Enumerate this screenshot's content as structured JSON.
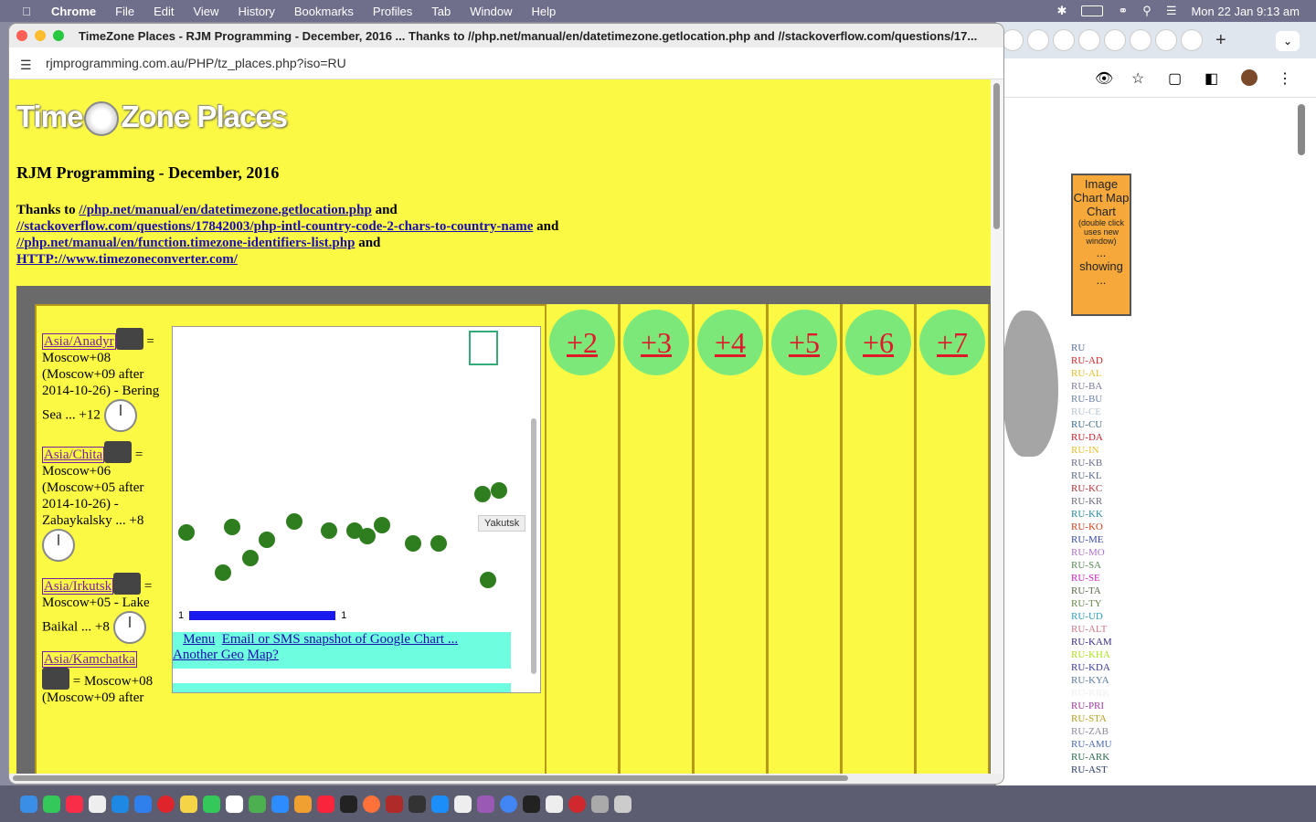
{
  "menubar": {
    "app": "Chrome",
    "items": [
      "File",
      "Edit",
      "View",
      "History",
      "Bookmarks",
      "Profiles",
      "Tab",
      "Window",
      "Help"
    ],
    "datetime": "Mon 22 Jan  9:13 am"
  },
  "window": {
    "title": "TimeZone Places - RJM Programming - December, 2016 ... Thanks to //php.net/manual/en/datetimezone.getlocation.php and //stackoverflow.com/questions/17...",
    "url": "rjmprogramming.com.au/PHP/tz_places.php?iso=RU"
  },
  "page": {
    "logo_left": "Time",
    "logo_right": "Zone Places",
    "heading": "RJM Programming - December, 2016",
    "thanks_prefix": "Thanks to",
    "links": [
      "//php.net/manual/en/datetimezone.getlocation.php",
      "//stackoverflow.com/questions/17842003/php-intl-country-code-2-chars-to-country-name",
      "//php.net/manual/en/function.timezone-identifiers-list.php",
      "HTTP://www.timezoneconverter.com/"
    ],
    "and": "and"
  },
  "places": [
    {
      "name": "Asia/Anadyr",
      "desc": "= Moscow+08 (Moscow+09 after 2014-10-26) - Bering Sea ... +12"
    },
    {
      "name": "Asia/Chita",
      "desc": "= Moscow+06 (Moscow+05 after 2014-10-26) - Zabaykalsky ... +8"
    },
    {
      "name": "Asia/Irkutsk",
      "desc": "= Moscow+05 - Lake Baikal ... +8"
    },
    {
      "name": "Asia/Kamchatka",
      "desc": "= Moscow+08 (Moscow+09 after"
    }
  ],
  "map": {
    "tooltip": "Yakutsk",
    "legend_min": "1",
    "legend_max": "1",
    "menu": "Menu",
    "email_link": "Email or SMS snapshot of Google Chart ...",
    "another_geo": "Another Geo",
    "map_q": "Map?"
  },
  "offsets": [
    "+2",
    "+3",
    "+4",
    "+5",
    "+6",
    "+7"
  ],
  "sidebar": {
    "image_chart": "Image Chart Map Chart",
    "image_chart_note": "(double click uses new window)",
    "showing": "... showing ...",
    "iso_codes": [
      {
        "code": "RU",
        "color": "#5a6ea8"
      },
      {
        "code": "RU-AD",
        "color": "#d0282c"
      },
      {
        "code": "RU-AL",
        "color": "#e3c032"
      },
      {
        "code": "RU-BA",
        "color": "#7a7a9a"
      },
      {
        "code": "RU-BU",
        "color": "#6a7fa8"
      },
      {
        "code": "RU-CE",
        "color": "#b4c4d2"
      },
      {
        "code": "RU-CU",
        "color": "#3c6a8a"
      },
      {
        "code": "RU-DA",
        "color": "#c8202a"
      },
      {
        "code": "RU-IN",
        "color": "#e8c030"
      },
      {
        "code": "RU-KB",
        "color": "#6a6a8a"
      },
      {
        "code": "RU-KL",
        "color": "#5a6a8a"
      },
      {
        "code": "RU-KC",
        "color": "#b0303a"
      },
      {
        "code": "RU-KR",
        "color": "#6a6a7a"
      },
      {
        "code": "RU-KK",
        "color": "#2a8a9a"
      },
      {
        "code": "RU-KO",
        "color": "#d0401a"
      },
      {
        "code": "RU-ME",
        "color": "#3a4aa8"
      },
      {
        "code": "RU-MO",
        "color": "#b070c8"
      },
      {
        "code": "RU-SA",
        "color": "#5a8a5a"
      },
      {
        "code": "RU-SE",
        "color": "#d020c0"
      },
      {
        "code": "RU-TA",
        "color": "#5a6a4a"
      },
      {
        "code": "RU-TY",
        "color": "#6a8a4a"
      },
      {
        "code": "RU-UD",
        "color": "#2aa0c0"
      },
      {
        "code": "RU-ALT",
        "color": "#d07a8a"
      },
      {
        "code": "RU-KAM",
        "color": "#3a2a8a"
      },
      {
        "code": "RU-KHA",
        "color": "#b0e020"
      },
      {
        "code": "RU-KDA",
        "color": "#3a3aa0"
      },
      {
        "code": "RU-KYA",
        "color": "#5a7a9a"
      },
      {
        "code": "RU-KRK",
        "color": "#f0f0f0"
      },
      {
        "code": "RU-PRI",
        "color": "#a03aa0"
      },
      {
        "code": "RU-STA",
        "color": "#b0a020"
      },
      {
        "code": "RU-ZAB",
        "color": "#8a8a9a"
      },
      {
        "code": "RU-AMU",
        "color": "#4a6ab0"
      },
      {
        "code": "RU-ARK",
        "color": "#2a6a4a"
      },
      {
        "code": "RU-AST",
        "color": "#2a3a6a"
      }
    ]
  }
}
